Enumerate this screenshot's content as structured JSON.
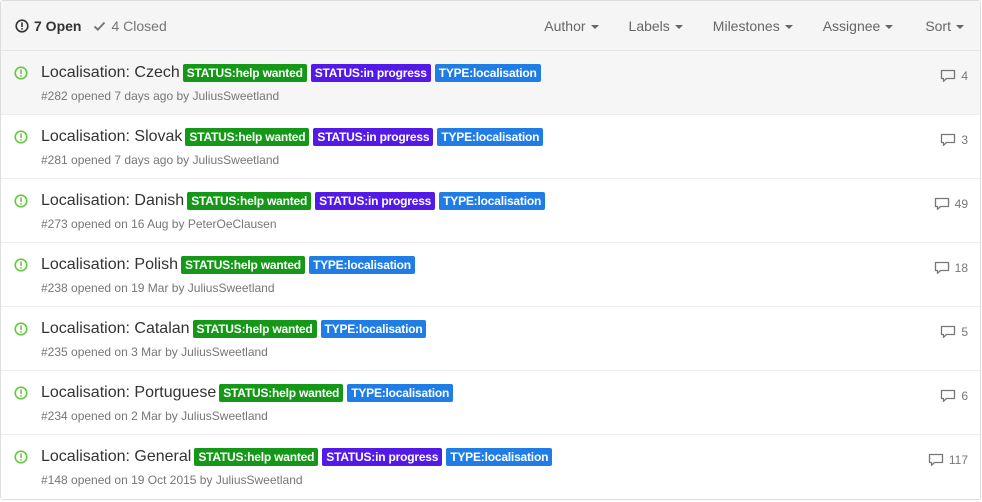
{
  "header": {
    "open_label": "7 Open",
    "closed_label": "4 Closed",
    "filters": [
      "Author",
      "Labels",
      "Milestones",
      "Assignee",
      "Sort"
    ]
  },
  "issues": [
    {
      "title": "Localisation: Czech",
      "labels": [
        {
          "text": "STATUS:help wanted",
          "kind": "help"
        },
        {
          "text": "STATUS:in progress",
          "kind": "progress"
        },
        {
          "text": "TYPE:localisation",
          "kind": "local"
        }
      ],
      "meta": "#282 opened 7 days ago by",
      "author": "JuliusSweetland",
      "comments": "4"
    },
    {
      "title": "Localisation: Slovak",
      "labels": [
        {
          "text": "STATUS:help wanted",
          "kind": "help"
        },
        {
          "text": "STATUS:in progress",
          "kind": "progress"
        },
        {
          "text": "TYPE:localisation",
          "kind": "local"
        }
      ],
      "meta": "#281 opened 7 days ago by",
      "author": "JuliusSweetland",
      "comments": "3"
    },
    {
      "title": "Localisation: Danish",
      "labels": [
        {
          "text": "STATUS:help wanted",
          "kind": "help"
        },
        {
          "text": "STATUS:in progress",
          "kind": "progress"
        },
        {
          "text": "TYPE:localisation",
          "kind": "local"
        }
      ],
      "meta": "#273 opened on 16 Aug by",
      "author": "PeterOeClausen",
      "comments": "49"
    },
    {
      "title": "Localisation: Polish",
      "labels": [
        {
          "text": "STATUS:help wanted",
          "kind": "help"
        },
        {
          "text": "TYPE:localisation",
          "kind": "local"
        }
      ],
      "meta": "#238 opened on 19 Mar by",
      "author": "JuliusSweetland",
      "comments": "18"
    },
    {
      "title": "Localisation: Catalan",
      "labels": [
        {
          "text": "STATUS:help wanted",
          "kind": "help"
        },
        {
          "text": "TYPE:localisation",
          "kind": "local"
        }
      ],
      "meta": "#235 opened on 3 Mar by",
      "author": "JuliusSweetland",
      "comments": "5"
    },
    {
      "title": "Localisation: Portuguese",
      "labels": [
        {
          "text": "STATUS:help wanted",
          "kind": "help"
        },
        {
          "text": "TYPE:localisation",
          "kind": "local"
        }
      ],
      "meta": "#234 opened on 2 Mar by",
      "author": "JuliusSweetland",
      "comments": "6"
    },
    {
      "title": "Localisation: General",
      "labels": [
        {
          "text": "STATUS:help wanted",
          "kind": "help"
        },
        {
          "text": "STATUS:in progress",
          "kind": "progress"
        },
        {
          "text": "TYPE:localisation",
          "kind": "local"
        }
      ],
      "meta": "#148 opened on 19 Oct 2015 by",
      "author": "JuliusSweetland",
      "comments": "117"
    }
  ],
  "colors": {
    "label_help": "#159818",
    "label_progress": "#5319e7",
    "label_local": "#207de5",
    "open_icon": "#6cc644"
  },
  "icons": {
    "open_filter": "issue-opened-icon",
    "closed_filter": "check-icon",
    "issue_state": "issue-opened-icon",
    "comments": "comment-icon"
  }
}
